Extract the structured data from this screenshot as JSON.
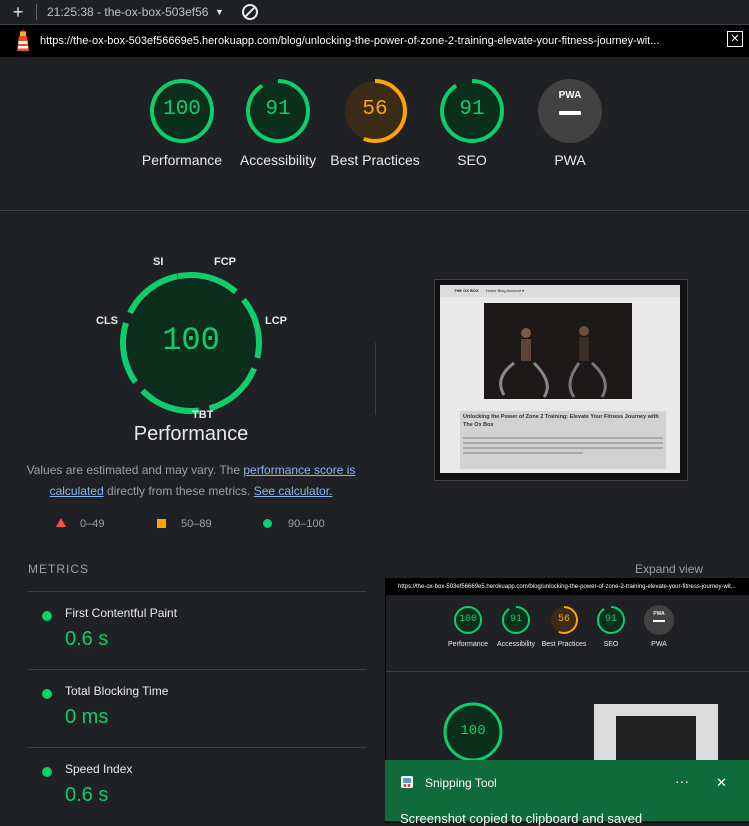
{
  "toolbar": {
    "add": "+",
    "report_label": "21:25:38 - the-ox-box-503ef56",
    "caret": "▼"
  },
  "url": "https://the-ox-box-503ef56669e5.herokuapp.com/blog/unlocking-the-power-of-zone-2-training-elevate-your-fitness-journey-wit...",
  "url_close": "✕",
  "categories": [
    {
      "label": "Performance",
      "score": "100",
      "status": "pass"
    },
    {
      "label": "Accessibility",
      "score": "91",
      "status": "pass"
    },
    {
      "label": "Best Practices",
      "score": "56",
      "status": "average"
    },
    {
      "label": "SEO",
      "score": "91",
      "status": "pass"
    },
    {
      "label": "PWA",
      "score": "",
      "status": "na"
    }
  ],
  "pwa_badge": "PWA",
  "performance": {
    "score": "100",
    "title": "Performance",
    "metric_labels": {
      "si": "SI",
      "fcp": "FCP",
      "lcp": "LCP",
      "cls": "CLS",
      "tbt": "TBT"
    },
    "note_prefix": "Values are estimated and may vary. The ",
    "note_link1": "performance score is calculated",
    "note_mid": " directly from these metrics. ",
    "note_link2": "See calculator."
  },
  "legend": [
    {
      "range": "0–49",
      "color": "#ff4e42"
    },
    {
      "range": "50–89",
      "color": "#ffa400"
    },
    {
      "range": "90–100",
      "color": "#0cce6b"
    }
  ],
  "screenshot": {
    "brand": "THE OX BOX",
    "nav": "Home   Blog   Account ▾",
    "heading": "Unlocking the Power of Zone 2 Training: Elevate Your Fitness Journey with The Ox Box"
  },
  "metrics": {
    "heading": "METRICS",
    "expand": "Expand view",
    "items": [
      {
        "name": "First Contentful Paint",
        "value": "0.6 s"
      },
      {
        "name": "Total Blocking Time",
        "value": "0 ms"
      },
      {
        "name": "Speed Index",
        "value": "0.6 s"
      }
    ]
  },
  "overlay": {
    "url": "https://the-ox-box-503ef56669e5.herokuapp.com/blog/unlocking-the-power-of-zone-2-training-elevate-your-fitness-journey-wit...",
    "big_score": "100"
  },
  "toast": {
    "app": "Snipping Tool",
    "more": "···",
    "close": "✕",
    "message": "Screenshot copied to clipboard and saved"
  },
  "colors": {
    "pass": "#0cce6b",
    "average": "#ffa400",
    "fail": "#ff4e42",
    "accent_link": "#8ab4f8"
  }
}
